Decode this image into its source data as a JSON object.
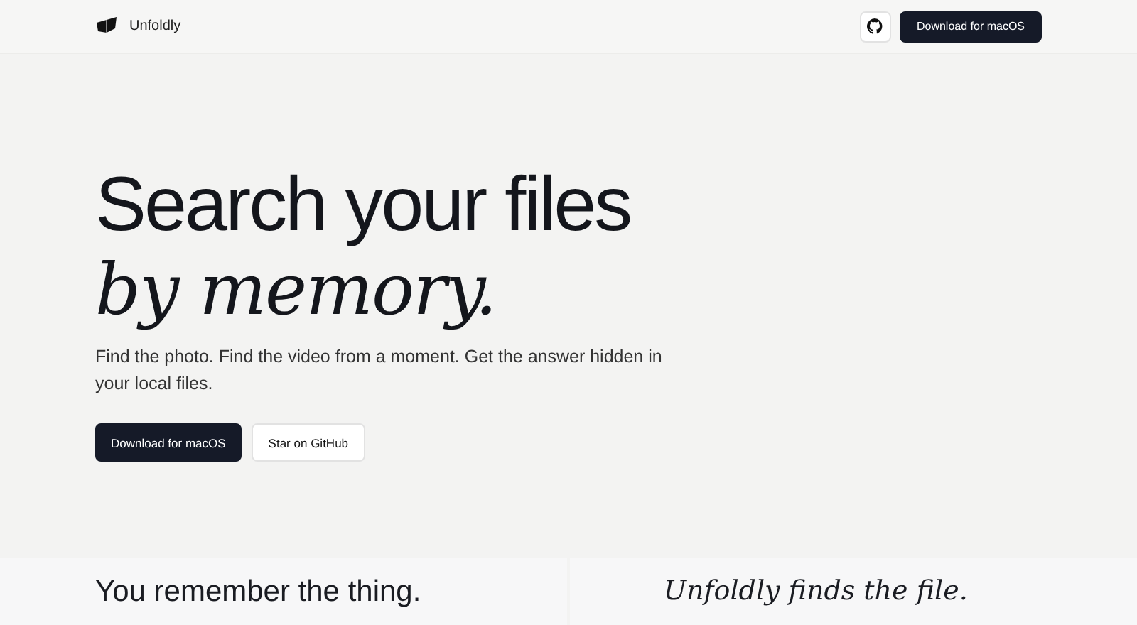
{
  "header": {
    "brand": "Unfoldly",
    "download_button": "Download for macOS"
  },
  "hero": {
    "title_line_1": "Search your files",
    "title_line_2": "by memory.",
    "description": "Find the photo. Find the video from a moment. Get the answer hidden in your local files.",
    "buttons": [
      {
        "label": "Download for macOS",
        "kind": "primary"
      },
      {
        "label": "Star on GitHub",
        "kind": "secondary"
      }
    ]
  },
  "panels": [
    {
      "text": "You remember the thing.",
      "kind": "sans"
    },
    {
      "text": "Unfoldly finds the file.",
      "kind": "serif"
    }
  ]
}
